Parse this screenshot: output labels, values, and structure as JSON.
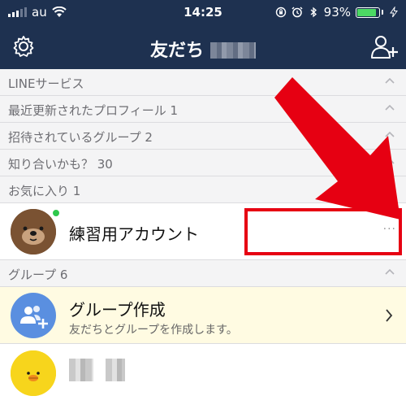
{
  "status_bar": {
    "carrier": "au",
    "time": "14:25",
    "battery_percent": "93%",
    "battery_level": 0.93
  },
  "nav": {
    "title": "友だち"
  },
  "sections": {
    "line_services": "LINEサービス",
    "recent_profiles": "最近更新されたプロフィール 1",
    "invited_groups": "招待されているグループ 2",
    "maybe_know": "知り合いかも？ 30",
    "favorites": "お気に入り 1",
    "groups": "グループ 6"
  },
  "favorite_row": {
    "name": "練習用アカウント",
    "more": "···"
  },
  "group_create": {
    "name": "グループ作成",
    "description": "友だちとグループを作成します。"
  },
  "colors": {
    "nav_bg": "#1e3150",
    "annotation_red": "#e60012",
    "battery_green": "#4cd964",
    "online_green": "#2fc84c"
  }
}
